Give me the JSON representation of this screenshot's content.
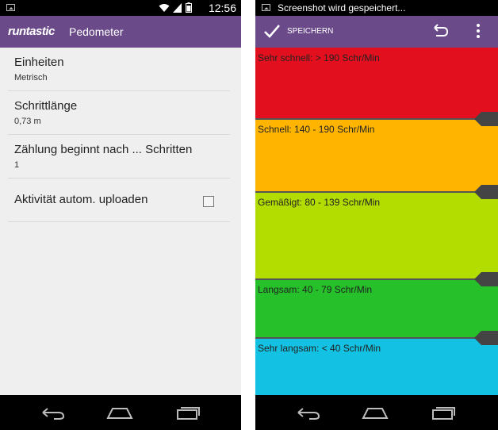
{
  "left": {
    "status": {
      "time": "12:56"
    },
    "app": {
      "brand": "runtastic",
      "title": "Pedometer"
    },
    "settings": [
      {
        "title": "Einheiten",
        "value": "Metrisch"
      },
      {
        "title": "Schrittlänge",
        "value": "0,73 m"
      },
      {
        "title": "Zählung beginnt nach ... Schritten",
        "value": "1"
      },
      {
        "title": "Aktivität autom. uploaden",
        "checked": false
      }
    ]
  },
  "right": {
    "status": {
      "notification": "Screenshot wird gespeichert..."
    },
    "actionbar": {
      "save_label": "SPEICHERN"
    },
    "zones": [
      {
        "label": "Sehr schnell: > 190 Schr/Min",
        "color": "#e2101f"
      },
      {
        "label": "Schnell: 140 - 190 Schr/Min",
        "color": "#ffb400"
      },
      {
        "label": "Gemäßigt: 80 - 139 Schr/Min",
        "color": "#b3dc00"
      },
      {
        "label": "Langsam: 40 - 79 Schr/Min",
        "color": "#26c12a"
      },
      {
        "label": "Sehr langsam: < 40 Schr/Min",
        "color": "#13c2e3"
      }
    ]
  },
  "colors": {
    "appbar": "#6b4a8a",
    "statusbar": "#000000",
    "navbar": "#000000"
  }
}
